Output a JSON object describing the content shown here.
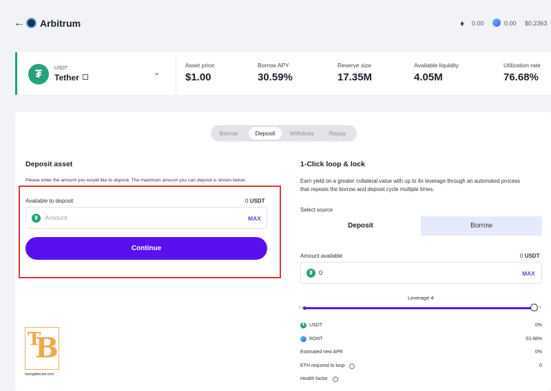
{
  "topbar": {
    "back_icon": "arrow-left-icon",
    "network_name": "Arbitrum",
    "eth_balance": "0.00",
    "rdnt_balance": "0.00",
    "rdnt_price": "$0.2363"
  },
  "asset": {
    "symbol": "USDT",
    "name": "Tether",
    "stats": [
      {
        "label": "Asset price",
        "value": "$1.00"
      },
      {
        "label": "Borrow APY",
        "value": "30.59%"
      },
      {
        "label": "Reserve size",
        "value": "17.35M"
      },
      {
        "label": "Available liquidity",
        "value": "4.05M"
      },
      {
        "label": "Utilization rate",
        "value": "76.68%"
      }
    ]
  },
  "tabs": [
    "Borrow",
    "Deposit",
    "Withdraw",
    "Repay"
  ],
  "active_tab": "Deposit",
  "deposit": {
    "title": "Deposit asset",
    "instructions": "Please enter the amount you would like to deposit. The maximum amount you can deposit is shown below.",
    "available_label": "Available to deposit",
    "available_amount": "0",
    "available_unit": "USDT",
    "amount_placeholder": "Amount",
    "max_label": "MAX",
    "continue_label": "Continue"
  },
  "loop": {
    "title": "1-Click loop & lock",
    "description": "Earn yield on a greater collateral value with up to 4x leverage through an automated process that repeats the borrow and deposit cycle multiple times.",
    "select_source_label": "Select source",
    "source_deposit": "Deposit",
    "source_borrow": "Borrow",
    "amount_available_label": "Amount available",
    "amount_available_value": "0",
    "amount_available_unit": "USDT",
    "amount_value": "0",
    "max_label": "MAX",
    "leverage_label": "Leverage 4",
    "leverage_value": 4,
    "slider_min": "1.1",
    "slider_max": "4",
    "rows": [
      {
        "label": "USDT",
        "value": "0%"
      },
      {
        "label": "RDNT",
        "value": "53.98%"
      },
      {
        "label": "Estimated new APR",
        "value": "0%"
      },
      {
        "label": "ETH required to loop",
        "value": "0"
      },
      {
        "label": "Health factor",
        "value": ""
      }
    ]
  },
  "watermark": {
    "url": "huongdancoin.com"
  },
  "colors": {
    "accent": "#5a0fef",
    "tether": "#26a17b",
    "highlight": "#d33333",
    "borrow_source_bg": "#e4e9fb"
  }
}
